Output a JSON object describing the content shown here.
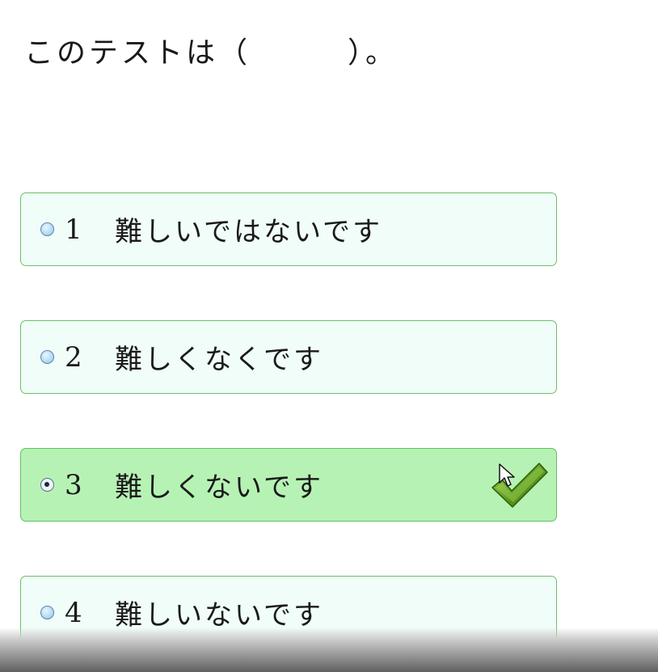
{
  "question": {
    "text": "このテストは（　　　）。"
  },
  "choices": [
    {
      "number": "1",
      "label": "難しいではないです",
      "selected": false
    },
    {
      "number": "2",
      "label": "難しくなくです",
      "selected": false
    },
    {
      "number": "3",
      "label": "難しくないです",
      "selected": true
    },
    {
      "number": "4",
      "label": "難しいないです",
      "selected": false
    }
  ],
  "icons": {
    "correct": "checkmark-icon",
    "pointer": "mouse-cursor-icon"
  },
  "colors": {
    "option_bg": "#f1fdf8",
    "selected_bg": "#b7f2b5",
    "border": "#6cbf6a",
    "checkmark": "#5a9a1c"
  }
}
